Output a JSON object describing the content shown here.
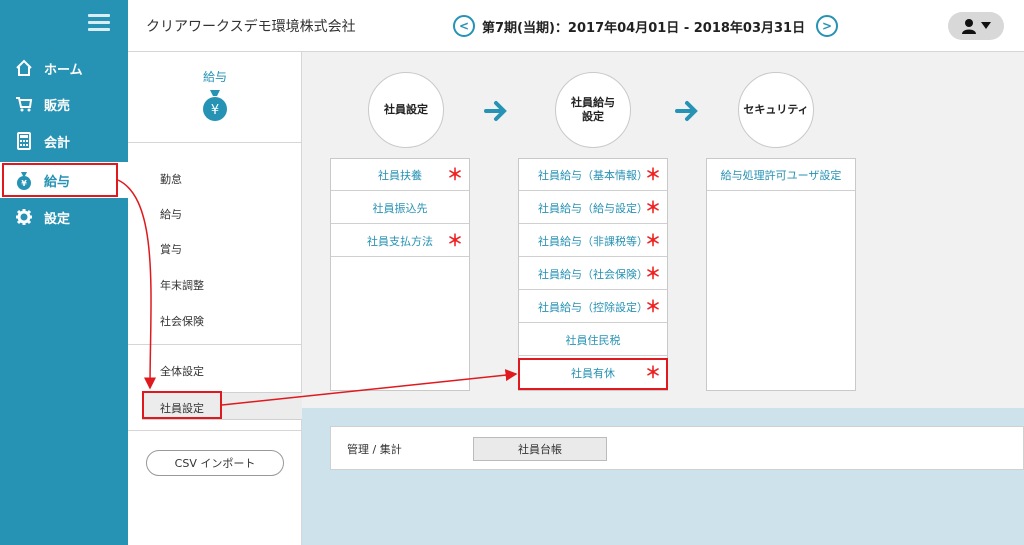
{
  "company_name": "クリアワークスデモ環境株式会社",
  "period": "第7期(当期)：2017年04月01日 - 2018年03月31日",
  "nav": {
    "items": [
      {
        "label": "ホーム",
        "icon": "home-icon"
      },
      {
        "label": "販売",
        "icon": "cart-icon"
      },
      {
        "label": "会計",
        "icon": "calculator-icon"
      },
      {
        "label": "給与",
        "icon": "money-bag-icon",
        "active": true
      },
      {
        "label": "設定",
        "icon": "gear-icon"
      }
    ]
  },
  "submenu": {
    "title": "給与",
    "icon": "money-bag-icon",
    "items": [
      "勤怠",
      "給与",
      "賞与",
      "年末調整",
      "社会保険"
    ],
    "items2": [
      "全体設定",
      "社員設定"
    ],
    "active": "社員設定",
    "csv_button": "CSV インポート"
  },
  "flow": {
    "steps": [
      "社員設定",
      "社員給与\n設定",
      "セキュリティ"
    ]
  },
  "columns": {
    "employee_settings": [
      {
        "label": "社員扶養",
        "required": true
      },
      {
        "label": "社員振込先",
        "required": false
      },
      {
        "label": "社員支払方法",
        "required": true
      }
    ],
    "salary_settings": [
      {
        "label": "社員給与（基本情報）",
        "required": true
      },
      {
        "label": "社員給与（給与設定）",
        "required": true
      },
      {
        "label": "社員給与（非課税等）",
        "required": true
      },
      {
        "label": "社員給与（社会保険）",
        "required": true
      },
      {
        "label": "社員給与（控除設定）",
        "required": true
      },
      {
        "label": "社員住民税",
        "required": false
      },
      {
        "label": "社員有休",
        "required": true
      }
    ],
    "security": [
      {
        "label": "給与処理許可ユーザ設定",
        "required": false
      }
    ]
  },
  "required_mark": "＊",
  "management": {
    "label": "管理 / 集計",
    "button": "社員台帳"
  },
  "colors": {
    "accent": "#2692b4",
    "annotation": "#e0191e",
    "required": "#e22222"
  }
}
